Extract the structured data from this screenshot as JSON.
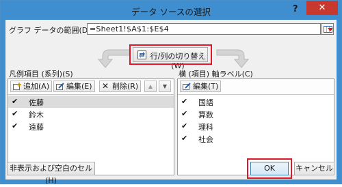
{
  "window": {
    "title": "データ ソースの選択",
    "help": "?",
    "close": "✕"
  },
  "range": {
    "label": "グラフ データの範囲(D):",
    "value": "=Sheet1!$A$1:$E$4"
  },
  "switch_button": {
    "label": "行/列の切り替え(W)"
  },
  "legend": {
    "header": "凡例項目 (系列)(S)",
    "add": "追加(A)",
    "edit": "編集(E)",
    "remove": "削除(R)",
    "up": "▲",
    "down": "▼",
    "items": [
      {
        "label": "佐藤",
        "checked": true,
        "selected": true
      },
      {
        "label": "鈴木",
        "checked": true,
        "selected": false
      },
      {
        "label": "遠藤",
        "checked": true,
        "selected": false
      }
    ]
  },
  "axis": {
    "header": "横 (項目) 軸ラベル(C)",
    "edit": "編集(T)",
    "items": [
      {
        "label": "国語",
        "checked": true
      },
      {
        "label": "算数",
        "checked": true
      },
      {
        "label": "理科",
        "checked": true
      },
      {
        "label": "社会",
        "checked": true
      }
    ]
  },
  "footer": {
    "hidden_cells": "非表示および空白のセル(H)",
    "ok": "OK",
    "cancel": "キャンセル"
  },
  "check_glyph": "✔",
  "icons": [
    "help-icon",
    "close-icon",
    "range-select-icon",
    "switch-icon",
    "add-icon",
    "edit-icon",
    "remove-icon",
    "up-arrow-icon",
    "down-arrow-icon",
    "checkbox-icon"
  ],
  "colors": {
    "titlebar": "#3e8ed0",
    "close": "#c7392f",
    "highlight": "#e0162b",
    "selected_row": "#dcdcdc"
  }
}
